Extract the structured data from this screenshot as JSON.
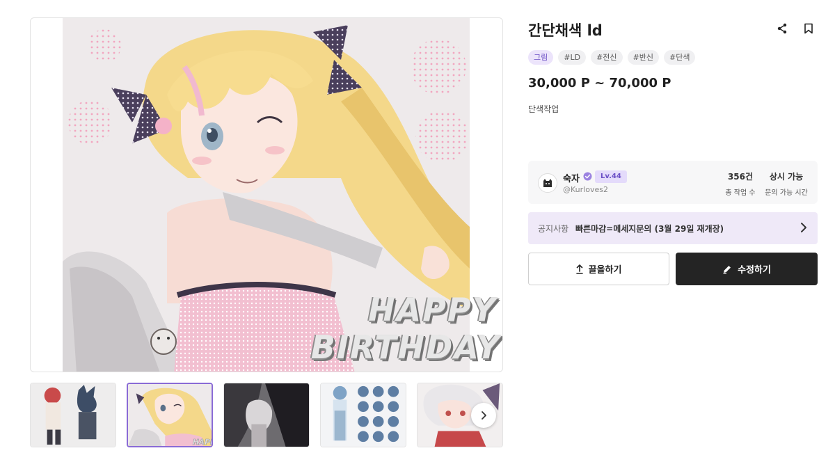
{
  "product": {
    "title": "간단채색 ld",
    "tags": [
      {
        "label": "그림",
        "primary": true
      },
      {
        "label": "#LD",
        "primary": false
      },
      {
        "label": "#전신",
        "primary": false
      },
      {
        "label": "#반신",
        "primary": false
      },
      {
        "label": "#단색",
        "primary": false
      }
    ],
    "price": "30,000 P ~ 70,000 P",
    "description": "단색작업"
  },
  "artwork": {
    "overlay_line1": "HAPPY",
    "overlay_line2": "BIRTHDAY"
  },
  "thumbnails": {
    "count": 5,
    "selected_index": 1,
    "overlay_text": "HAPPY"
  },
  "seller": {
    "name": "숙자",
    "level": "Lv.44",
    "handle": "@Kurloves2",
    "stats": [
      {
        "value": "356건",
        "label": "총 작업 수"
      },
      {
        "value": "상시 가능",
        "label": "문의 가능 시간"
      }
    ]
  },
  "notice": {
    "label": "공지사항",
    "text": "빠른마감=메세지문의 (3월 29일 재개장)"
  },
  "actions": {
    "bump_label": "끌올하기",
    "edit_label": "수정하기"
  },
  "icons": {
    "share": "share-icon",
    "bookmark": "bookmark-icon",
    "next": "chevron-right-icon",
    "bump": "upload-arrow-icon",
    "edit": "pencil-icon",
    "verified": "verified-badge-icon"
  },
  "colors": {
    "accent": "#8a6bd6",
    "notice_bg": "#efe9f8",
    "primary_button": "#242424"
  }
}
